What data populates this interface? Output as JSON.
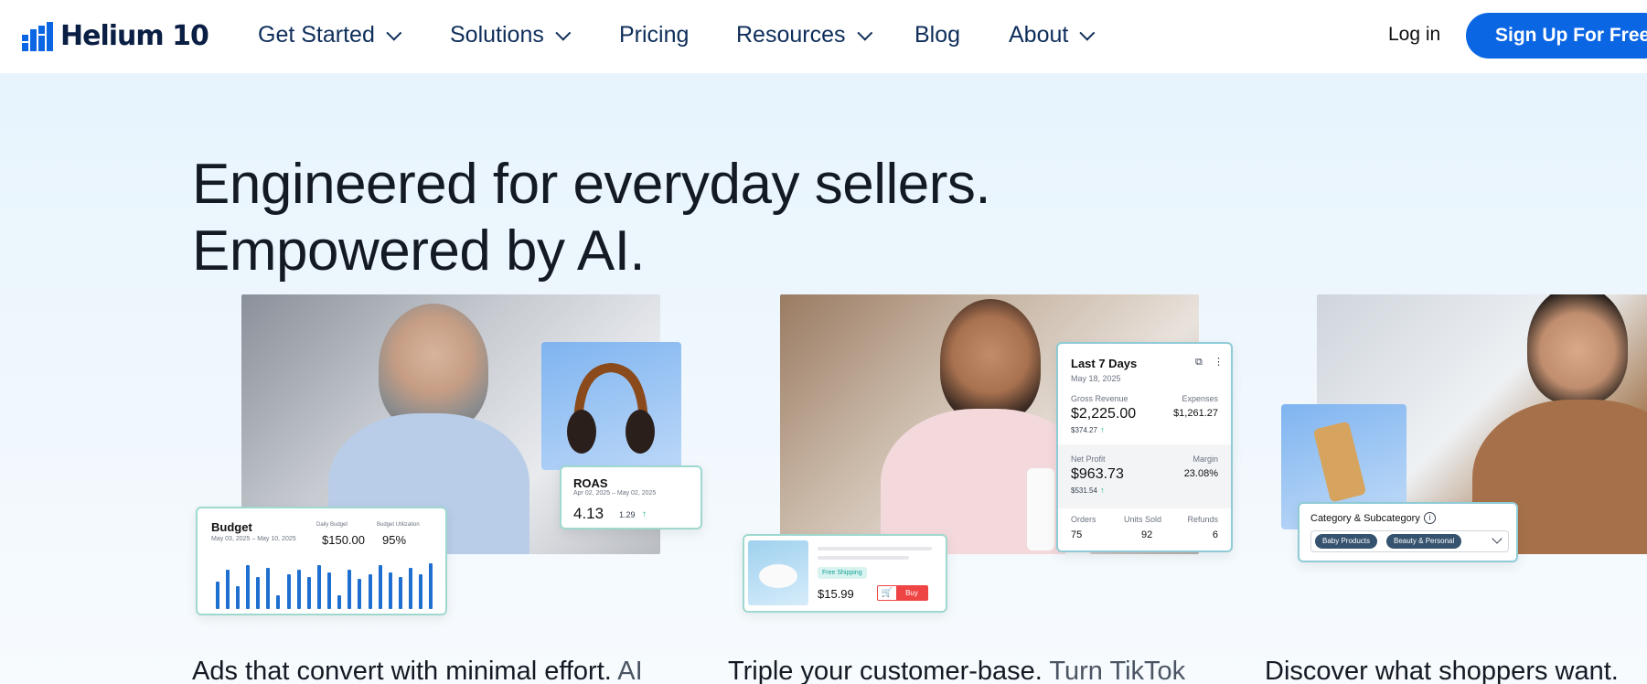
{
  "nav": {
    "logo_text": "Helium 10",
    "items": [
      {
        "label": "Get Started",
        "dropdown": true
      },
      {
        "label": "Solutions",
        "dropdown": true
      },
      {
        "label": "Pricing",
        "dropdown": false
      },
      {
        "label": "Resources",
        "dropdown": true
      },
      {
        "label": "Blog",
        "dropdown": false
      },
      {
        "label": "About",
        "dropdown": true
      }
    ],
    "login_label": "Log in",
    "signup_label": "Sign Up For Free",
    "accent": "#0b66e4"
  },
  "hero": {
    "headline_line1": "Engineered for everyday sellers.",
    "headline_line2": "Empowered by AI."
  },
  "card1": {
    "roas": {
      "title": "ROAS",
      "date": "Apr 02, 2025 – May 02, 2025",
      "value": "4.13",
      "change": "1.29"
    },
    "budget": {
      "title": "Budget",
      "date": "May 03, 2025 – May 10, 2025",
      "daily_label": "Daily Budget",
      "daily_value": "$150.00",
      "util_label": "Budget Utilization",
      "util_value": "95%",
      "bars": [
        0.6,
        0.85,
        0.5,
        0.95,
        0.7,
        0.9,
        0.3,
        0.75,
        0.85,
        0.7,
        0.95,
        0.8,
        0.3,
        0.85,
        0.65,
        0.75,
        0.95,
        0.8,
        0.7,
        0.9,
        0.75,
        1.0
      ]
    },
    "caption_bold": "Ads that convert with minimal effort.",
    "caption_light": "AI"
  },
  "card2": {
    "stats": {
      "title": "Last 7 Days",
      "date": "May 18, 2025",
      "gross_label": "Gross Revenue",
      "gross_value": "$2,225.00",
      "gross_change": "$374.27",
      "expenses_label": "Expenses",
      "expenses_value": "$1,261.27",
      "net_label": "Net Profit",
      "net_value": "$963.73",
      "net_change": "$531.54",
      "margin_label": "Margin",
      "margin_value": "23.08%",
      "orders_label": "Orders",
      "orders_value": "75",
      "units_label": "Units Sold",
      "units_value": "92",
      "refunds_label": "Refunds",
      "refunds_value": "6"
    },
    "product": {
      "badge": "Free Shipping",
      "price": "$15.99",
      "buy_label": "Buy"
    },
    "caption_bold": "Triple your customer-base.",
    "caption_light": "Turn TikTok"
  },
  "card3": {
    "category": {
      "title": "Category & Subcategory",
      "tag1": "Baby Products",
      "tag2": "Beauty & Personal"
    },
    "caption_bold": "Discover what shoppers want."
  }
}
